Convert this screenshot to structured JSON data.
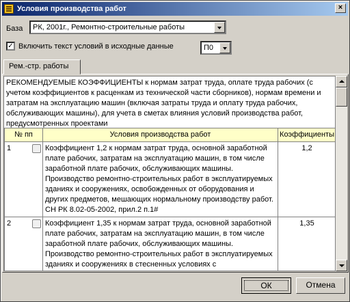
{
  "window": {
    "title": "Условия производства работ",
    "close_label": "×"
  },
  "base": {
    "label": "База",
    "value": "РК, 2001г., Ремонтно-строительные работы"
  },
  "include": {
    "checked_mark": "✓",
    "label": "Включить текст условий в исходные данные",
    "value": "П0"
  },
  "tab": {
    "label": "Рем.-стр. работы"
  },
  "intro": "РЕКОМЕНДУЕМЫЕ КОЭФФИЦИЕНТЫ к нормам затрат труда, оплате труда рабочих (с учетом коэффициентов к расценкам из технической части сборников), нормам времени и затратам на эксплуатацию машин (включая затраты труда и оплату труда рабочих, обслуживающих машины), для учета в сметах влияния условий производства работ, предусмотренных проектами",
  "table": {
    "headers": {
      "num": "№ пп",
      "conditions": "Условия производства работ",
      "coef": "Коэффициенты"
    },
    "rows": [
      {
        "num": "1",
        "text": "Коэффициент 1,2 к нормам затрат труда, основной заработной плате рабочих, затратам на эксплуатацию машин, в том числе заработной плате рабочих, обслуживающих машины. Производство ремонтно-строительных работ в эксплуатируемых зданиях и сооружениях, освобожденных от оборудования и других предметов, мешающих нормальному производству работ. СН РК 8.02-05-2002, прил.2 п.1#",
        "coef": "1,2"
      },
      {
        "num": "2",
        "text": "Коэффициент 1,35 к нормам затрат труда, основной заработной плате рабочих, затратам на эксплуатацию машин, в том числе заработной плате рабочих, обслуживающих машины. Производство ремонтно-строительных работ в эксплуатируемых зданиях и сооружениях в стесненных условиях с",
        "coef": "1,35"
      }
    ]
  },
  "buttons": {
    "ok": "ОК",
    "cancel": "Отмена"
  }
}
